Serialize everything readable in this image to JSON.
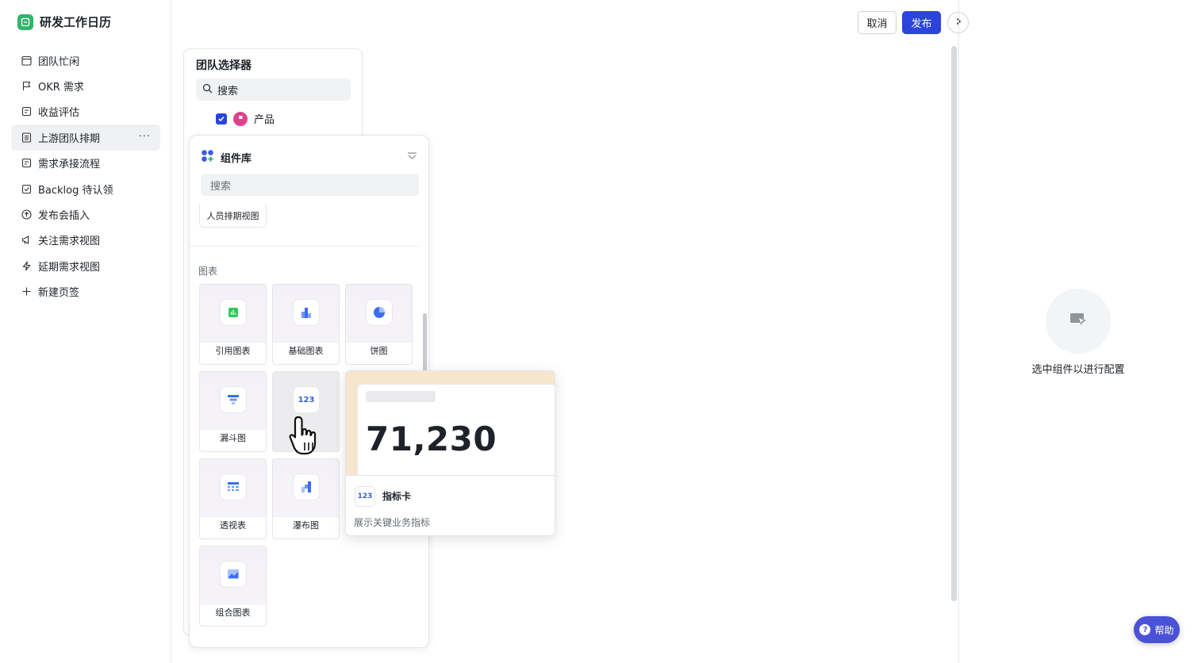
{
  "app": {
    "title": "研发工作日历"
  },
  "sidebar": {
    "items": [
      {
        "label": "团队忙闲",
        "icon": "calendar-icon"
      },
      {
        "label": "OKR 需求",
        "icon": "flag-icon"
      },
      {
        "label": "收益评估",
        "icon": "document-icon"
      },
      {
        "label": "上游团队排期",
        "icon": "list-icon",
        "active": true,
        "more": "···"
      },
      {
        "label": "需求承接流程",
        "icon": "document-icon"
      },
      {
        "label": "Backlog 待认领",
        "icon": "checkbox-icon"
      },
      {
        "label": "发布会插入",
        "icon": "upload-circle-icon"
      },
      {
        "label": "关注需求视图",
        "icon": "megaphone-icon"
      },
      {
        "label": "延期需求视图",
        "icon": "lightning-icon"
      },
      {
        "label": "新建页签",
        "icon": "plus-icon"
      }
    ]
  },
  "toolbar": {
    "cancel_label": "取消",
    "publish_label": "发布"
  },
  "team_selector": {
    "title": "团队选择器",
    "search_placeholder": "搜索",
    "items": [
      {
        "label": "产品",
        "checked": true
      }
    ]
  },
  "component_library": {
    "title": "组件库",
    "search_placeholder": "搜索",
    "chip_label": "人员排期视图",
    "section_label": "图表",
    "tiles": [
      {
        "label": "引用图表",
        "icon": "reference-chart-icon"
      },
      {
        "label": "基础图表",
        "icon": "bar-chart-icon"
      },
      {
        "label": "饼图",
        "icon": "pie-chart-icon"
      },
      {
        "label": "漏斗图",
        "icon": "funnel-chart-icon"
      },
      {
        "label": "",
        "icon": "metric-card-icon",
        "icon_text": "123"
      },
      {
        "label": "透视表",
        "icon": "pivot-table-icon"
      },
      {
        "label": "瀑布图",
        "icon": "waterfall-chart-icon"
      },
      {
        "label": "组合图表",
        "icon": "combo-chart-icon"
      }
    ]
  },
  "preview": {
    "value": "71,230",
    "icon_text": "123",
    "name": "指标卡",
    "description": "展示关键业务指标"
  },
  "right_panel": {
    "empty_text": "选中组件以进行配置"
  },
  "help": {
    "label": "帮助",
    "icon_text": "?"
  },
  "colors": {
    "primary": "#2b44db",
    "help": "#4b52d9",
    "app_logo": "#34b36b"
  }
}
